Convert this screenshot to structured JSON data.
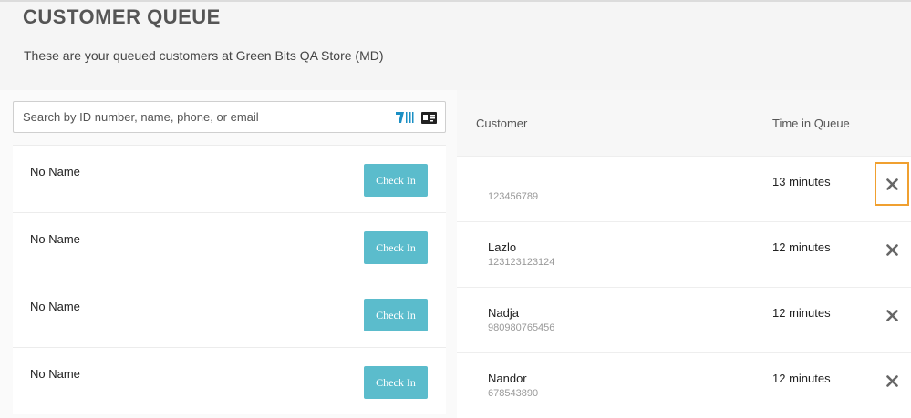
{
  "header": {
    "title": "CUSTOMER QUEUE",
    "subtitle": "These are your queued customers at Green Bits QA Store (MD)"
  },
  "search": {
    "placeholder": "Search by ID number, name, phone, or email",
    "icons": [
      "barcode-scan-icon",
      "id-card-icon"
    ]
  },
  "pending_list": {
    "items": [
      {
        "name": "No Name",
        "action": "Check In"
      },
      {
        "name": "No Name",
        "action": "Check In"
      },
      {
        "name": "No Name",
        "action": "Check In"
      },
      {
        "name": "No Name",
        "action": "Check In"
      }
    ]
  },
  "queue_table": {
    "columns": {
      "customer": "Customer",
      "time": "Time in Queue"
    },
    "rows": [
      {
        "name": "",
        "id": "123456789",
        "time": "13 minutes"
      },
      {
        "name": "Lazlo",
        "id": "123123123124",
        "time": "12 minutes"
      },
      {
        "name": "Nadja",
        "id": "980980765456",
        "time": "12 minutes"
      },
      {
        "name": "Nandor",
        "id": "678543890",
        "time": "12 minutes"
      }
    ],
    "remove_icon": "close-icon"
  },
  "colors": {
    "accent": "#5bbccc",
    "focus": "#f0a030",
    "scan_icon": "#1a8fc4"
  }
}
